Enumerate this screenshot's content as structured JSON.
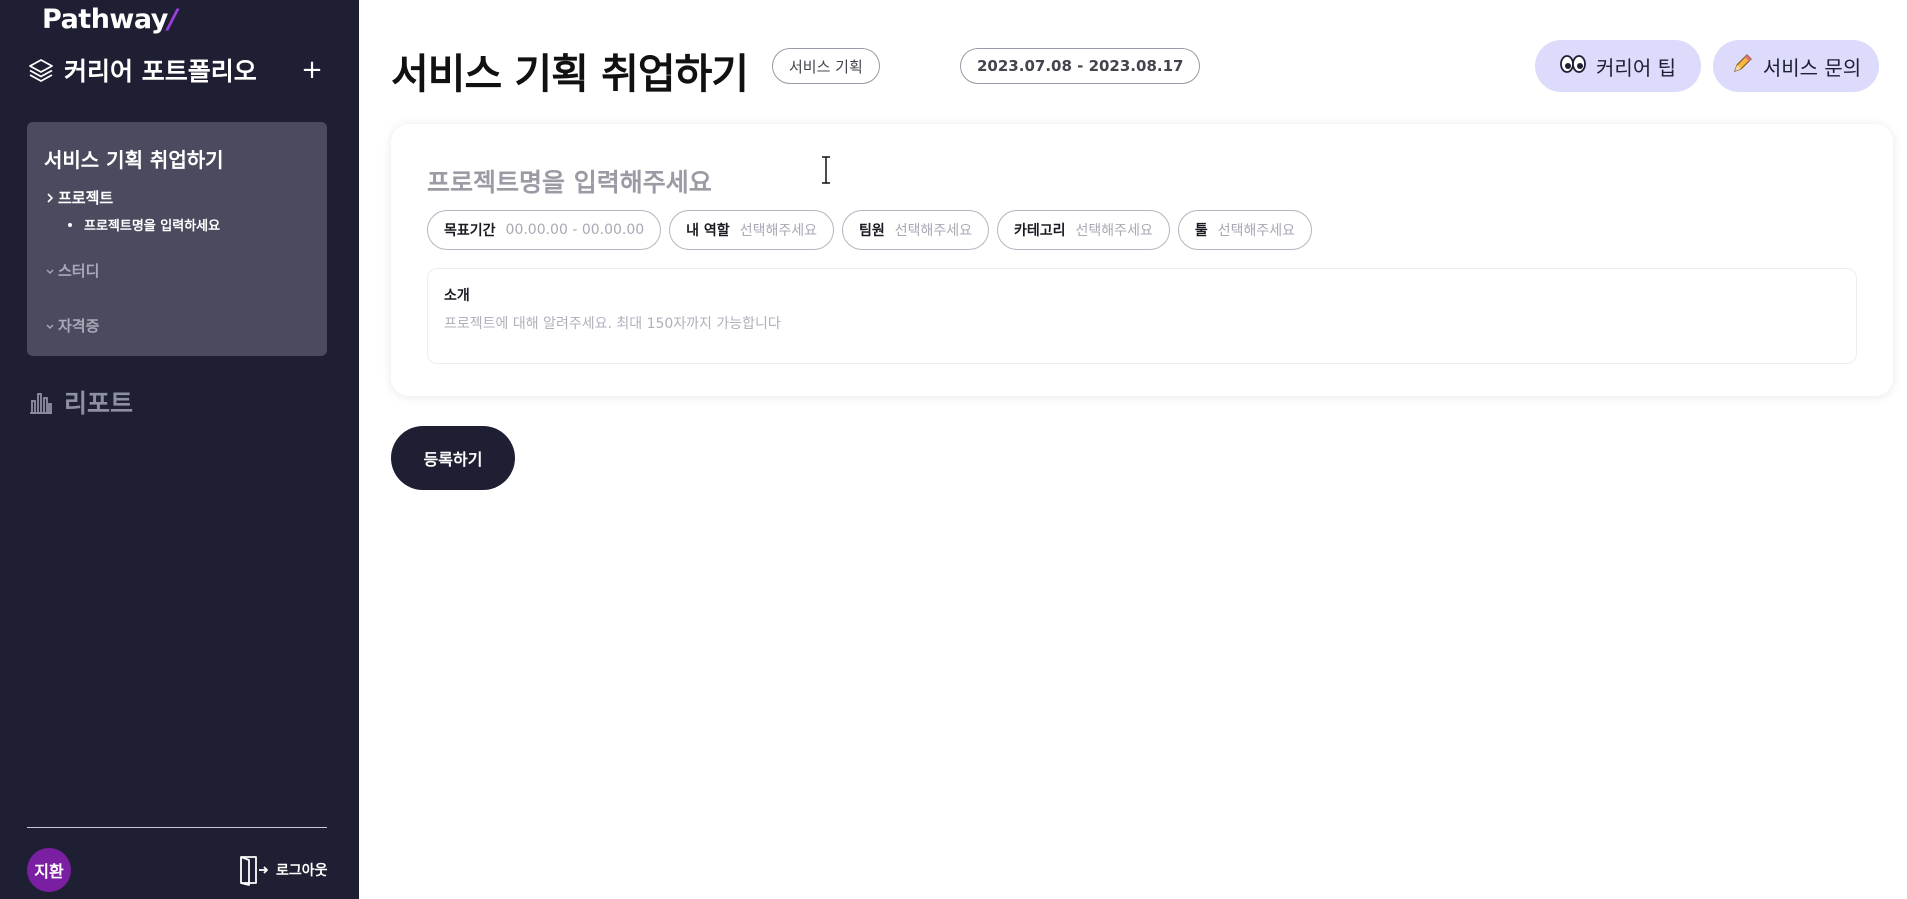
{
  "app": {
    "logo_text": "Pathway",
    "logo_accent": "/"
  },
  "sidebar": {
    "portfolio_title": "커리어 포트폴리오",
    "add_label": "+",
    "card": {
      "title": "서비스 기획 취업하기",
      "items": [
        {
          "label": "프로젝트",
          "state": "expanded"
        },
        {
          "label": "스터디",
          "state": "collapsed"
        },
        {
          "label": "자격증",
          "state": "collapsed"
        }
      ],
      "sub_item": "프로젝트명을 입력하세요"
    },
    "report_label": "리포트",
    "user_initials": "지환",
    "logout_label": "로그아웃"
  },
  "main": {
    "page_title": "서비스 기획 취업하기",
    "category_chip": "서비스 기획",
    "date_chip": "2023.07.08 - 2023.08.17",
    "tip_button": "커리어 팁",
    "inquiry_button": "서비스 문의",
    "tip_icon": "eyes-icon",
    "inquiry_icon": "pencil-icon",
    "form": {
      "project_placeholder": "프로젝트명을 입력해주세요",
      "fields": [
        {
          "label": "목표기간",
          "value": "00.00.00 - 00.00.00"
        },
        {
          "label": "내 역할",
          "value": "선택해주세요"
        },
        {
          "label": "팀원",
          "value": "선택해주세요"
        },
        {
          "label": "카테고리",
          "value": "선택해주세요"
        },
        {
          "label": "툴",
          "value": "선택해주세요"
        }
      ],
      "intro_label": "소개",
      "intro_placeholder": "프로젝트에 대해 알려주세요. 최대 150자까지 가능합니다"
    },
    "submit_label": "등록하기"
  },
  "colors": {
    "sidebar_bg": "#1e1f33",
    "card_bg": "#4a4b5e",
    "accent_purple": "#7b1fa2",
    "button_lavender": "#dddbfb"
  }
}
